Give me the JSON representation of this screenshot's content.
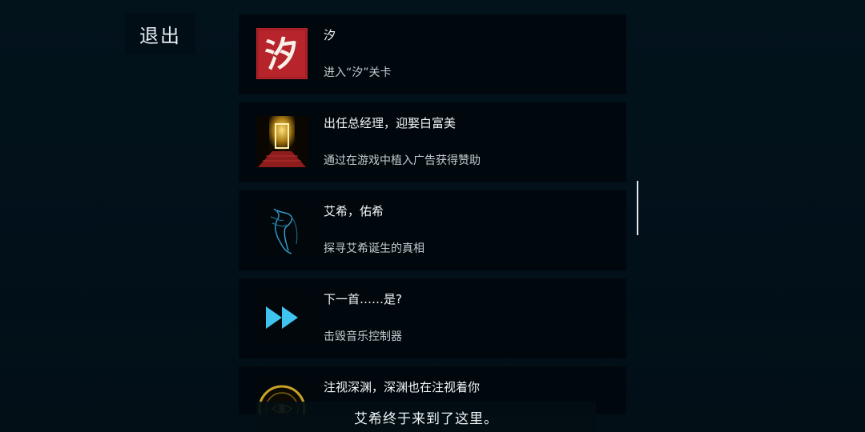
{
  "exit_label": "退出",
  "achievements": [
    {
      "title": "汐",
      "description": "进入“汐”关卡",
      "icon": "xi-calligraphy-icon",
      "icon_glyph": "汐"
    },
    {
      "title": "出任总经理，迎娶白富美",
      "description": "通过在游戏中植入广告获得赞助",
      "icon": "golden-door-icon"
    },
    {
      "title": "艾希，佑希",
      "description": "探寻艾希诞生的真相",
      "icon": "blue-sketch-figure-icon"
    },
    {
      "title": "下一首……是?",
      "description": "击毁音乐控制器",
      "icon": "fast-forward-icon"
    },
    {
      "title": "注视深渊，深渊也在注视着你",
      "description": "",
      "icon": "abyss-eye-icon"
    }
  ],
  "subtitle": "艾希终于来到了这里。",
  "colors": {
    "background": "#02111a",
    "card": "#01080d",
    "xi_icon_bg": "#b7242b",
    "fast_forward": "#3fc4f0",
    "gold": "#c9a227"
  }
}
